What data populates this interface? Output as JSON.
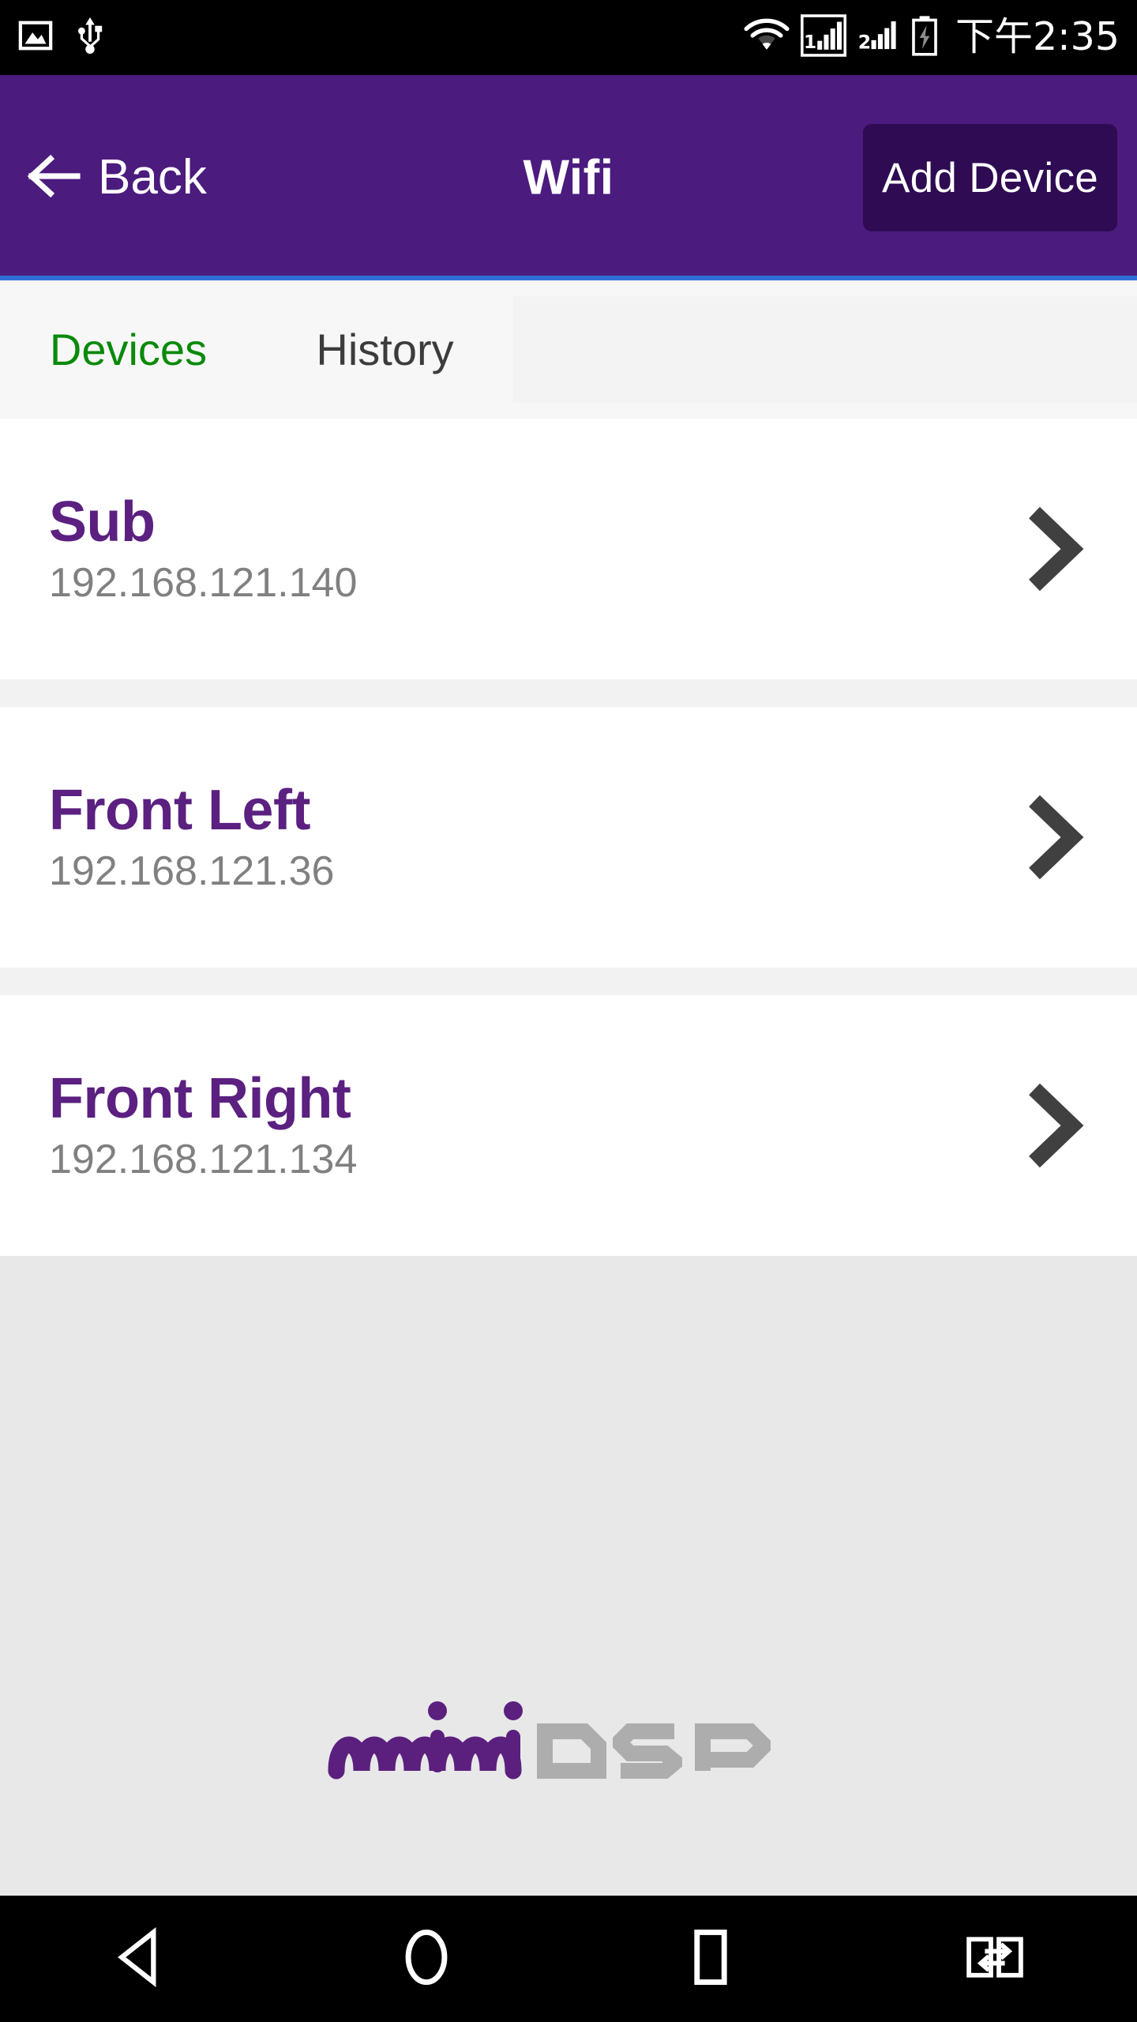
{
  "status_bar": {
    "icons_left": [
      "image-icon",
      "usb-icon"
    ],
    "icons_right": [
      "wifi-icon",
      "sim1-signal-icon",
      "sim2-signal-icon",
      "battery-charging-icon"
    ],
    "sim1_label": "1",
    "sim2_label": "2",
    "time": "下午2:35"
  },
  "header": {
    "back_label": "Back",
    "title": "Wifi",
    "add_device_label": "Add Device",
    "bg_color": "#4B1B7E",
    "button_color": "#2E0B52",
    "underline_color": "#2f6fd6"
  },
  "tabs": {
    "items": [
      {
        "label": "Devices",
        "active": true,
        "color": "#0a8a0a"
      },
      {
        "label": "History",
        "active": false,
        "color": "#3c3c3c"
      }
    ]
  },
  "devices": {
    "rows": [
      {
        "name": "Sub",
        "ip": "192.168.121.140"
      },
      {
        "name": "Front Left",
        "ip": "192.168.121.36"
      },
      {
        "name": "Front Right",
        "ip": "192.168.121.134"
      }
    ],
    "name_color": "#5B2080",
    "ip_color": "#808080",
    "chevron_color": "#404040"
  },
  "branding": {
    "logo_primary": "mini",
    "logo_secondary": "DSP",
    "primary_color": "#5B1F7E",
    "secondary_color": "#adadad"
  },
  "nav_bar": {
    "buttons": [
      {
        "name": "back-nav-button",
        "icon": "triangle-left-icon"
      },
      {
        "name": "home-nav-button",
        "icon": "circle-icon"
      },
      {
        "name": "recents-nav-button",
        "icon": "square-icon"
      },
      {
        "name": "split-screen-nav-button",
        "icon": "screen-swap-icon"
      }
    ]
  }
}
